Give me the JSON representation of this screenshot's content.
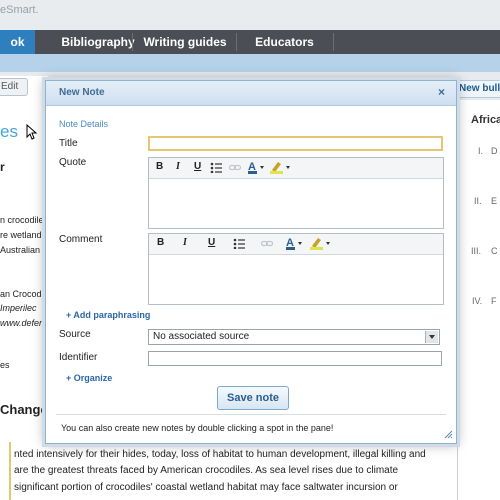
{
  "brand": {
    "text": "eSmart."
  },
  "nav": {
    "tabs": [
      {
        "label": "ok",
        "active": true
      },
      {
        "label": "Bibliography",
        "active": false
      },
      {
        "label": "Writing guides",
        "active": false
      },
      {
        "label": "Educators",
        "active": false
      }
    ]
  },
  "left": {
    "edit_button": "Edit",
    "heading": "es",
    "sub": "r",
    "lines": [
      {
        "text": "n crocodile",
        "italic": false
      },
      {
        "text": "re wetland",
        "italic": false
      },
      {
        "text": "Australian",
        "italic": false
      },
      {
        "text": "an Crocodi",
        "italic": false
      },
      {
        "text": "Imperilec",
        "italic": true
      },
      {
        "text": "www.defenc",
        "italic": true
      },
      {
        "text": "es",
        "italic": false
      }
    ],
    "section_heading": "Change",
    "body": [
      "nted intensively for their hides, today, loss of habitat to human development, illegal killing and",
      "are the greatest threats faced by American crocodiles. As sea level rises due to climate",
      "significant portion of crocodiles' coastal wetland habitat may face saltwater incursion or"
    ]
  },
  "right": {
    "new_bullet": "New bulle",
    "heading": "Africa",
    "items": [
      "I.",
      "II.",
      "III.",
      "IV."
    ],
    "item_letters": [
      "D",
      "E",
      "C",
      "F"
    ]
  },
  "dialog": {
    "title": "New Note",
    "close_label": "×",
    "section": "Note Details",
    "title_label": "Title",
    "title_value": "",
    "quote_label": "Quote",
    "comment_label": "Comment",
    "toolbar": {
      "bold": "B",
      "italic": "I",
      "underline": "U"
    },
    "add_paraphrasing": "+ Add paraphrasing",
    "source_label": "Source",
    "source_value": "No associated source",
    "identifier_label": "Identifier",
    "identifier_value": "",
    "organize": "+ Organize",
    "save_button": "Save note",
    "hint": "You can also create new notes by double clicking a spot in the pane!"
  },
  "colors": {
    "accent": "#2f7fbf",
    "nav_bg": "#4b4f55",
    "dialog_border": "#8fb2cf",
    "focus": "#e6c675"
  }
}
